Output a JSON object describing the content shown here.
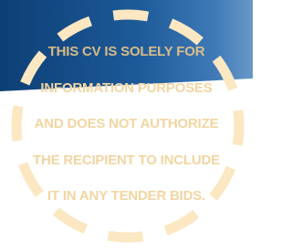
{
  "disclaimer": {
    "lines": [
      "THIS CV IS SOLELY FOR",
      "INFORMATION PURPOSES",
      "AND DOES NOT AUTHORIZE",
      "THE RECIPIENT TO INCLUDE",
      "IT IN ANY TENDER BIDS."
    ]
  },
  "colors": {
    "banner_dark": "#0d3f75",
    "banner_light": "#4d84bf",
    "dashes": "#fbe7c2",
    "text": "#f2d5a1"
  },
  "icons": {
    "ring": "dashed-circle"
  }
}
